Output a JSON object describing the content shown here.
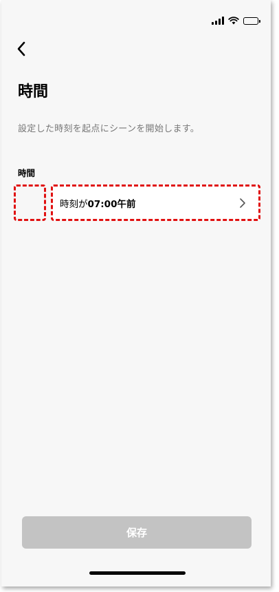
{
  "header": {
    "title": "時間",
    "description": "設定した時刻を起点にシーンを開始します。"
  },
  "section": {
    "label": "時間"
  },
  "time_row": {
    "prefix": "時刻が",
    "value": "07:00午前"
  },
  "footer": {
    "save_label": "保存"
  },
  "colors": {
    "highlight": "#e01010",
    "save_disabled": "#c3c3c3",
    "background": "#f7f7f7"
  },
  "icons": [
    "signal-icon",
    "wifi-icon",
    "battery-icon",
    "back-arrow-icon",
    "chevron-right-icon"
  ]
}
